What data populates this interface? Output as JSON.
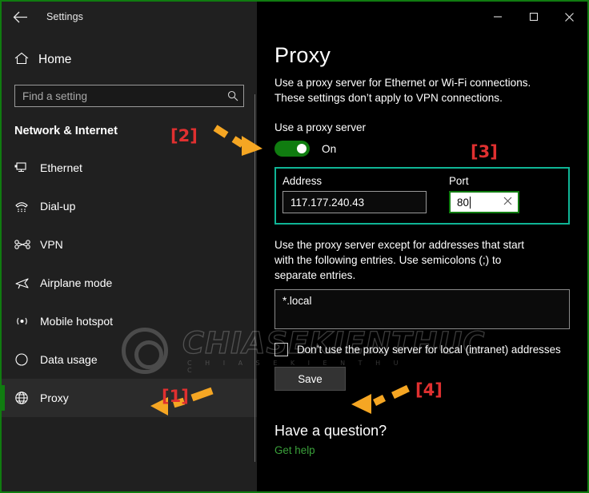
{
  "window": {
    "title": "Settings",
    "back_icon": "back-arrow-icon",
    "controls": {
      "minimize": "minimize-icon",
      "maximize": "maximize-icon",
      "close": "close-icon"
    },
    "border_color": "#107c10"
  },
  "sidebar": {
    "home": {
      "label": "Home",
      "icon": "home-icon"
    },
    "search": {
      "placeholder": "Find a setting",
      "icon": "search-icon",
      "value": ""
    },
    "category": "Network & Internet",
    "items": [
      {
        "label": "Ethernet",
        "icon": "ethernet-icon",
        "selected": false
      },
      {
        "label": "Dial-up",
        "icon": "dialup-phone-icon",
        "selected": false
      },
      {
        "label": "VPN",
        "icon": "vpn-icon",
        "selected": false
      },
      {
        "label": "Airplane mode",
        "icon": "airplane-icon",
        "selected": false
      },
      {
        "label": "Mobile hotspot",
        "icon": "hotspot-icon",
        "selected": false
      },
      {
        "label": "Data usage",
        "icon": "data-usage-pie-icon",
        "selected": false
      },
      {
        "label": "Proxy",
        "icon": "globe-icon",
        "selected": true
      }
    ],
    "accent_color": "#107c10"
  },
  "main": {
    "title": "Proxy",
    "intro_line1": "Use a proxy server for Ethernet or Wi-Fi connections.",
    "intro_line2": "These settings don’t apply to VPN connections.",
    "use_proxy_label": "Use a proxy server",
    "toggle_state": "On",
    "toggle_color": "#107c10",
    "address": {
      "label": "Address",
      "value": "117.177.240.43"
    },
    "port": {
      "label": "Port",
      "value": "80",
      "clear_icon": "clear-x-icon"
    },
    "exclusion_line1": "Use the proxy server except for addresses that start",
    "exclusion_line2": "with the following entries. Use semicolons (;) to",
    "exclusion_line3": "separate entries.",
    "exclusion_value": "*.local",
    "checkbox_label": "Don’t use the proxy server for local (intranet) addresses",
    "checkbox_checked": false,
    "save_label": "Save",
    "question_title": "Have a question?",
    "help_link": "Get help",
    "highlight_color": "#0fb596"
  },
  "annotations": {
    "markers": [
      {
        "id": "marker-1",
        "label": "[1]"
      },
      {
        "id": "marker-2",
        "label": "[2]"
      },
      {
        "id": "marker-3",
        "label": "[3]"
      },
      {
        "id": "marker-4",
        "label": "[4]"
      }
    ],
    "arrow_color": "#f5a623"
  },
  "watermark": {
    "text": "CHIASEKIENTHUC",
    "subtext": "C H I A S E K I E N T H U C"
  }
}
